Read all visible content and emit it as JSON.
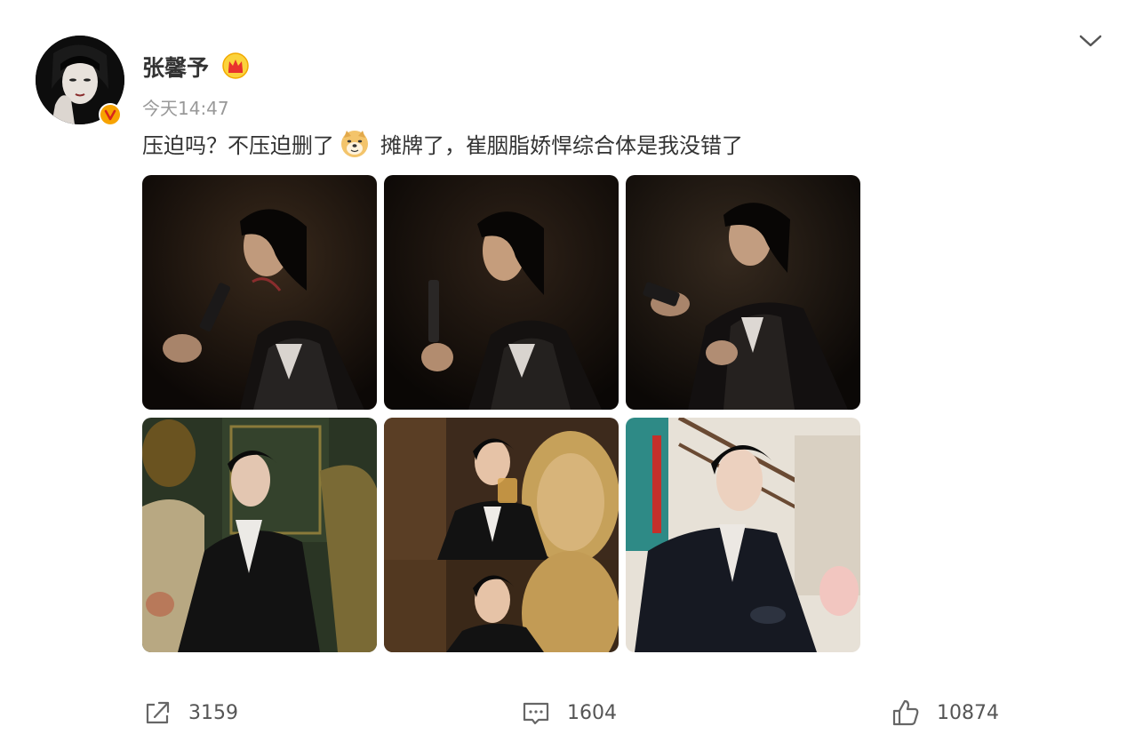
{
  "post": {
    "username": "张馨予",
    "timestamp": "今天14:47",
    "text_part1": "压迫吗？不压迫删了",
    "text_part2": "摊牌了，崔胭脂娇悍综合体是我没错了",
    "emoji": "doge-icon",
    "verified_badge": "yellow-v-icon",
    "member_badge": "crown-icon"
  },
  "photos": [
    {
      "name": "photo-1",
      "desc": "woman in suit holding gun, dark"
    },
    {
      "name": "photo-2",
      "desc": "woman profile holding gun upright, dark"
    },
    {
      "name": "photo-3",
      "desc": "woman looking down at gun, dark"
    },
    {
      "name": "photo-4",
      "desc": "woman seated on green sofa"
    },
    {
      "name": "photo-5",
      "desc": "woman drinking from glass, two frames"
    },
    {
      "name": "photo-6",
      "desc": "woman on staircase holding object"
    }
  ],
  "actions": {
    "repost_count": "3159",
    "comment_count": "1604",
    "like_count": "10874"
  },
  "colors": {
    "text": "#333333",
    "muted": "#999999",
    "badge": "#f7a300"
  }
}
